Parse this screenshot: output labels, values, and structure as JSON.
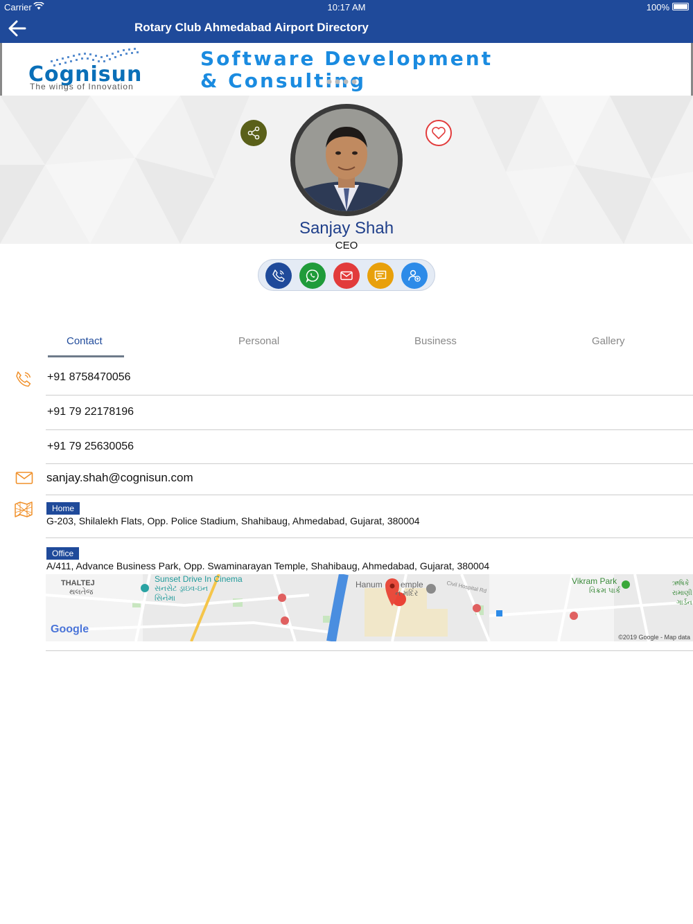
{
  "status_bar": {
    "carrier": "Carrier",
    "time": "10:17 AM",
    "battery": "100%"
  },
  "nav": {
    "title": "Rotary Club Ahmedabad Airport Directory"
  },
  "banner": {
    "logo_name": "Cognisun",
    "logo_tagline": "The wings of Innovation",
    "headline_line1": "Software Development",
    "headline_line2": "& Consulting",
    "pager_dots": 4
  },
  "profile": {
    "name": "Sanjay Shah",
    "role": "CEO"
  },
  "actions": [
    {
      "name": "call",
      "icon": "phone-icon",
      "color": "#1f4a9a"
    },
    {
      "name": "whatsapp",
      "icon": "whatsapp-icon",
      "color": "#1f9b3a"
    },
    {
      "name": "email",
      "icon": "mail-icon",
      "color": "#e23b3b"
    },
    {
      "name": "message",
      "icon": "message-icon",
      "color": "#e8a00b"
    },
    {
      "name": "add-contact",
      "icon": "add-contact-icon",
      "color": "#2d8be8"
    }
  ],
  "tabs": [
    {
      "label": "Contact",
      "active": true
    },
    {
      "label": "Personal",
      "active": false
    },
    {
      "label": "Business",
      "active": false
    },
    {
      "label": "Gallery",
      "active": false
    }
  ],
  "contact": {
    "phones": [
      "+91 8758470056",
      "+91 79 22178196",
      "+91 79 25630056"
    ],
    "email": "sanjay.shah@cognisun.com",
    "addresses": [
      {
        "tag": "Home",
        "text": "G-203, Shilalekh Flats, Opp. Police Stadium, Shahibaug, Ahmedabad, Gujarat, 380004"
      },
      {
        "tag": "Office",
        "text": "A/411, Advance Business Park, Opp. Swaminarayan Temple, Shahibaug, Ahmedabad, Gujarat, 380004"
      }
    ]
  },
  "map": {
    "labels": {
      "thaltej": "THALTEJ",
      "thaltej_gu": "થલતેજ",
      "sunset": "Sunset Drive In Cinema",
      "sunset_gu1": "સનસેટ ડ્રાઇવ-ઇન",
      "sunset_gu2": "સિનેમા",
      "hanuman": "Hanum",
      "temple": "emple",
      "temple_gu": "ન મંદિર",
      "civil": "Civil Hospital Rd",
      "vikram": "Vikram Park",
      "vikram_gu": "વિક્રમ પાર્ક",
      "east1": "ઋષિકે",
      "east2": "રામાણી",
      "east3": "ગાર્ડન"
    },
    "logo": "Google",
    "copyright": "©2019 Google - Map data"
  },
  "colors": {
    "primary": "#1f4a9a",
    "accent_orange": "#f0902a"
  }
}
